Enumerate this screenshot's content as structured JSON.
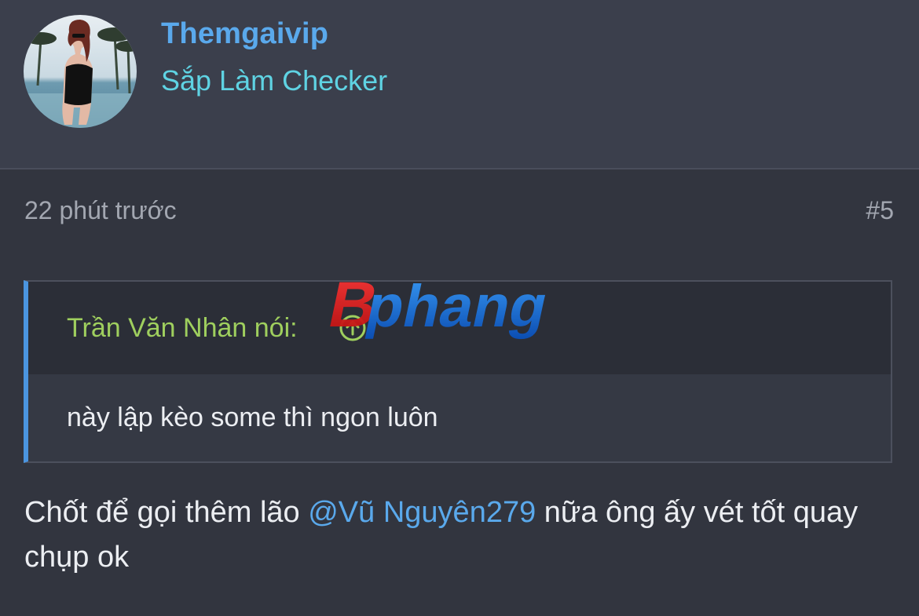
{
  "user": {
    "name": "Themgaivip",
    "title": "Sắp Làm Checker"
  },
  "post": {
    "time": "22 phút trước",
    "number": "#5",
    "quote": {
      "author": "Trần Văn Nhân nói:",
      "text": "này lập kèo some thì ngon luôn"
    },
    "body_before": "Chốt để gọi thêm lão ",
    "mention": "@Vũ Nguyên279",
    "body_after": " nữa ông ấy vét tốt quay chụp ok"
  },
  "watermark": {
    "text": "phang",
    "letter": "B"
  },
  "colors": {
    "background": "#32353f",
    "header_bg": "#3b3f4c",
    "username": "#5aa9ec",
    "user_title": "#5fd3e3",
    "quote_author": "#9fcf5e",
    "quote_border": "#4b95e0",
    "mention": "#5aa9ec"
  },
  "icons": {
    "avatar": "avatar-photo",
    "quote_jump": "arrow-up-circle-icon"
  }
}
